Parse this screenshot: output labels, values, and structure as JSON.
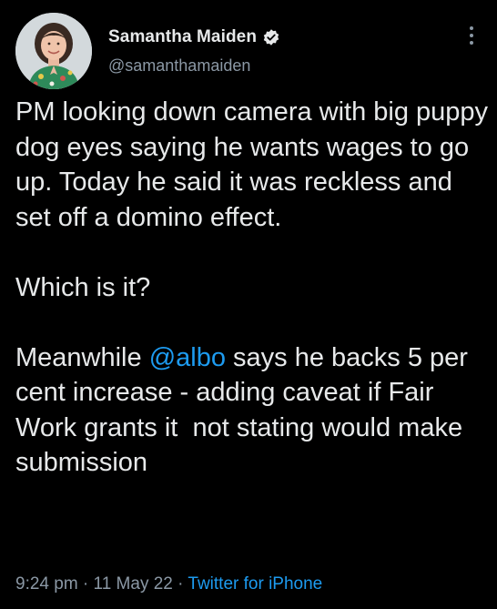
{
  "author": {
    "display_name": "Samantha Maiden",
    "handle": "@samanthamaiden",
    "verified": true,
    "avatar_icon": "profile-photo"
  },
  "more_icon": "more-vertical-icon",
  "tweet": {
    "paragraph_1": "PM looking down camera with big puppy dog eyes saying he wants wages to go up. Today he said it was reckless and set off a domino effect.",
    "paragraph_2": "Which is it?",
    "paragraph_3_before_mention": "Meanwhile ",
    "mention": "@albo",
    "paragraph_3_after_mention": " says he backs 5 per cent increase - adding caveat if Fair Work grants it  not stating would make submission"
  },
  "meta": {
    "time": "9:24 pm",
    "separator": " · ",
    "date": "11 May 22",
    "source": "Twitter for iPhone"
  },
  "colors": {
    "background": "#000000",
    "text": "#e7e9ea",
    "secondary": "#8b98a5",
    "accent": "#1d9bf0"
  }
}
